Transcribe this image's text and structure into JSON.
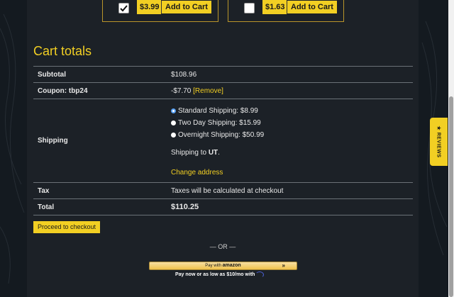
{
  "upsells": [
    {
      "checked": true,
      "price": "$3.99",
      "button": "Add to Cart"
    },
    {
      "checked": false,
      "price": "$1.63",
      "button": "Add to Cart"
    }
  ],
  "cart_totals": {
    "title": "Cart totals",
    "subtotal_label": "Subtotal",
    "subtotal_value": "$108.96",
    "coupon_label": "Coupon: tbp24",
    "coupon_value": "-$7.70",
    "coupon_remove": "[Remove]",
    "shipping_label": "Shipping",
    "shipping_options": [
      {
        "label": "Standard Shipping: $8.99",
        "selected": true
      },
      {
        "label": "Two Day Shipping: $15.99",
        "selected": false
      },
      {
        "label": "Overnight Shipping: $50.99",
        "selected": false
      }
    ],
    "shipping_to_prefix": "Shipping to ",
    "shipping_to_state": "UT",
    "shipping_to_suffix": ".",
    "change_address": "Change address",
    "tax_label": "Tax",
    "tax_value": "Taxes will be calculated at checkout",
    "total_label": "Total",
    "total_value": "$110.25"
  },
  "checkout_button": "Proceed to checkout",
  "or_divider": "— OR —",
  "amazon_pay": {
    "prefix": "Pay with",
    "brand": "amazon",
    "chevron": "»"
  },
  "financing_text": "Pay now or as low as $10/mo with",
  "reviews_tab": "★ REVIEWS",
  "colors": {
    "accent": "#f2cf23",
    "background": "#1c2127"
  }
}
